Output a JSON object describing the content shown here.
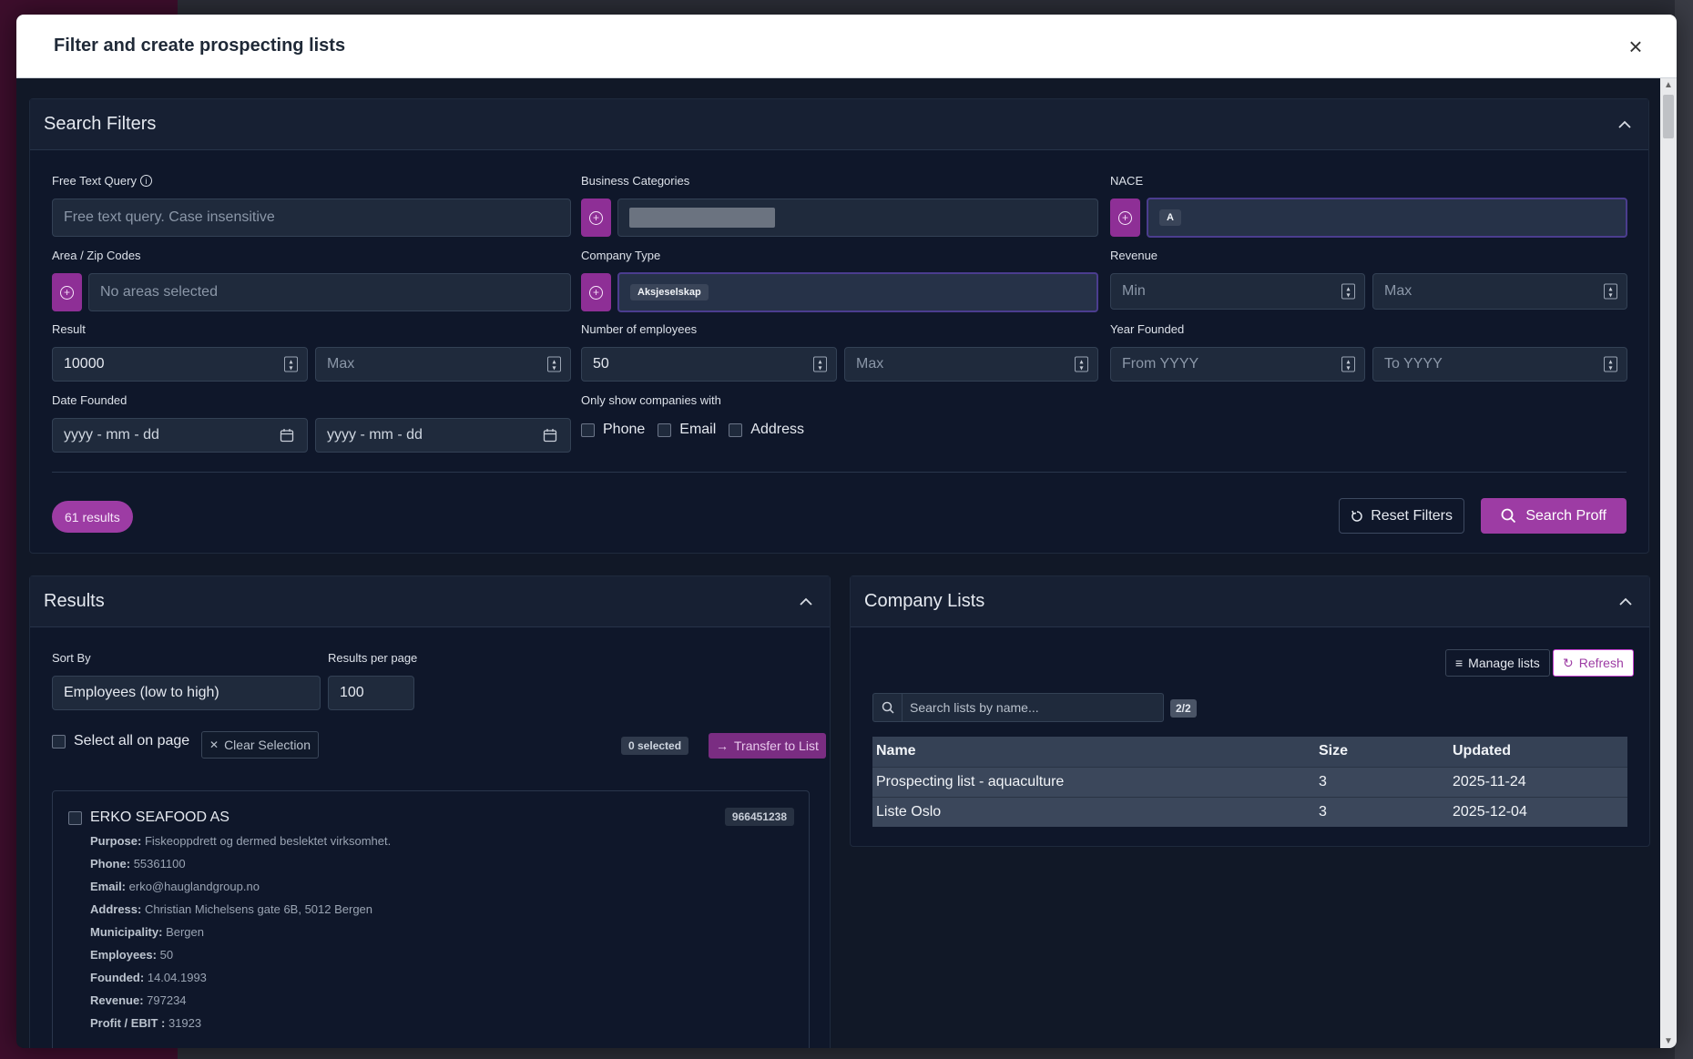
{
  "modal": {
    "title": "Filter and create prospecting lists",
    "close": "×"
  },
  "filters": {
    "title": "Search Filters",
    "free_text": {
      "label": "Free Text Query",
      "placeholder": "Free text query. Case insensitive"
    },
    "business_categories": {
      "label": "Business Categories"
    },
    "nace": {
      "label": "NACE",
      "chip": "A"
    },
    "area": {
      "label": "Area / Zip Codes",
      "placeholder": "No areas selected"
    },
    "company_type": {
      "label": "Company Type",
      "chip": "Aksjeselskap"
    },
    "revenue": {
      "label": "Revenue",
      "min_placeholder": "Min",
      "max_placeholder": "Max"
    },
    "result": {
      "label": "Result",
      "min_value": "10000",
      "max_placeholder": "Max"
    },
    "employees": {
      "label": "Number of employees",
      "min_value": "50",
      "max_placeholder": "Max"
    },
    "year_founded": {
      "label": "Year Founded",
      "from_placeholder": "From YYYY",
      "to_placeholder": "To YYYY"
    },
    "date_founded": {
      "label": "Date Founded",
      "from_placeholder": "yyyy - mm - dd",
      "to_placeholder": "yyyy - mm - dd"
    },
    "only_show": {
      "label": "Only show companies with",
      "phone": "Phone",
      "email": "Email",
      "address": "Address"
    },
    "results_count": "61 results",
    "reset_label": "Reset Filters",
    "search_label": "Search Proff"
  },
  "results": {
    "title": "Results",
    "sort_by_label": "Sort By",
    "sort_by_value": "Employees (low to high)",
    "per_page_label": "Results per page",
    "per_page_value": "100",
    "select_all_label": "Select all on page",
    "clear_selection_label": "Clear Selection",
    "selected_count": "0 selected",
    "transfer_label": "Transfer to List",
    "items": [
      {
        "name": "ERKO SEAFOOD AS",
        "org_number": "966451238",
        "purpose_label": "Purpose:",
        "purpose": "Fiskeoppdrett og dermed beslektet virksomhet.",
        "phone_label": "Phone:",
        "phone": "55361100",
        "email_label": "Email:",
        "email": "erko@hauglandgroup.no",
        "address_label": "Address:",
        "address": "Christian Michelsens gate 6B, 5012 Bergen",
        "municipality_label": "Municipality:",
        "municipality": "Bergen",
        "employees_label": "Employees:",
        "employees": "50",
        "founded_label": "Founded:",
        "founded": "14.04.1993",
        "revenue_label": "Revenue:",
        "revenue": "797234",
        "profit_label": "Profit / EBIT :",
        "profit": "31923"
      }
    ]
  },
  "lists": {
    "title": "Company Lists",
    "manage_label": "Manage lists",
    "refresh_label": "Refresh",
    "search_placeholder": "Search lists by name...",
    "count": "2/2",
    "columns": [
      "Name",
      "Size",
      "Updated"
    ],
    "rows": [
      {
        "name": "Prospecting list - aquaculture",
        "size": "3",
        "updated": "2025-11-24"
      },
      {
        "name": "Liste Oslo",
        "size": "3",
        "updated": "2025-12-04"
      }
    ]
  },
  "colors": {
    "accent": "#9d3ca4",
    "panel": "#0f172a",
    "header_bg": "#ffffff"
  }
}
